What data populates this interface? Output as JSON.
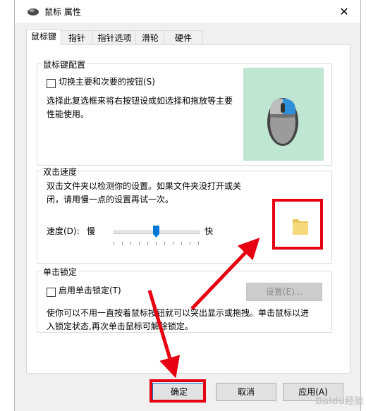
{
  "window": {
    "title": "鼠标 属性",
    "close_glyph": "✕"
  },
  "tabs": [
    {
      "label": "鼠标键"
    },
    {
      "label": "指针"
    },
    {
      "label": "指针选项"
    },
    {
      "label": "滑轮"
    },
    {
      "label": "硬件"
    }
  ],
  "button_config": {
    "group_label": "鼠标键配置",
    "checkbox_label": "切换主要和次要的按钮(S)",
    "checked": false,
    "description_line1": "选择此复选框来将右按钮设成如选择和拖放等主要",
    "description_line2": "性能使用。"
  },
  "double_click": {
    "group_label": "双击速度",
    "description_line1": "双击文件夹以检测你的设置。如果文件夹没打开或关",
    "description_line2": "闭，请用慢一点的设置再试一次。",
    "speed_label": "速度(D):",
    "slow_label": "慢",
    "fast_label": "快",
    "speed_value_fraction": 0.5
  },
  "click_lock": {
    "group_label": "单击锁定",
    "checkbox_label": "启用单击锁定(T)",
    "checked": false,
    "settings_button": "设置(E)...",
    "description_line1": "使你可以不用一直按着鼠标按钮就可以突出显示或拖拽。单击鼠标以进",
    "description_line2": "入锁定状态,再次单击鼠标可解除锁定。"
  },
  "footer": {
    "ok_label": "确定",
    "cancel_label": "取消",
    "apply_label": "应用(A)"
  },
  "watermark": "Baidu经验",
  "colors": {
    "annotation_red": "#e60012",
    "preview_bg": "#bfe6d3",
    "accent_blue": "#0078d7"
  }
}
